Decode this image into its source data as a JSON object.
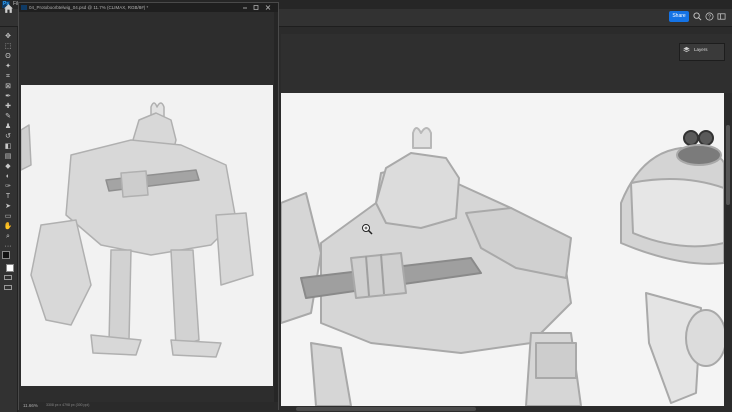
{
  "app": {
    "logo_text": "Ps",
    "menu_first": "File",
    "share_label": "Share"
  },
  "document": {
    "title": "04_Protoboorbtelwig_04.psd @ 11.7% (CLIMAX, RGB/8#) *",
    "zoom": "11.66%",
    "size_info": "3308 px x 4798 px (300 ppi)"
  },
  "panels": {
    "layers_label": "Layers"
  },
  "tools": [
    {
      "name": "move-tool",
      "glyph": "✥"
    },
    {
      "name": "marquee-tool",
      "glyph": "⬚"
    },
    {
      "name": "lasso-tool",
      "glyph": "ʘ"
    },
    {
      "name": "magic-wand-tool",
      "glyph": "✦"
    },
    {
      "name": "crop-tool",
      "glyph": "⌗"
    },
    {
      "name": "frame-tool",
      "glyph": "⊠"
    },
    {
      "name": "eyedropper-tool",
      "glyph": "✒"
    },
    {
      "name": "healing-tool",
      "glyph": "✚"
    },
    {
      "name": "brush-tool",
      "glyph": "✎"
    },
    {
      "name": "stamp-tool",
      "glyph": "♟"
    },
    {
      "name": "history-brush-tool",
      "glyph": "↺"
    },
    {
      "name": "eraser-tool",
      "glyph": "◧"
    },
    {
      "name": "gradient-tool",
      "glyph": "▤"
    },
    {
      "name": "blur-tool",
      "glyph": "◆"
    },
    {
      "name": "dodge-tool",
      "glyph": "◐"
    },
    {
      "name": "pen-tool",
      "glyph": "✑"
    },
    {
      "name": "type-tool",
      "glyph": "T"
    },
    {
      "name": "path-select-tool",
      "glyph": "➤"
    },
    {
      "name": "shape-tool",
      "glyph": "▭"
    },
    {
      "name": "hand-tool",
      "glyph": "✋"
    },
    {
      "name": "zoom-tool",
      "glyph": "⌕"
    },
    {
      "name": "more-tools",
      "glyph": "···"
    }
  ],
  "colors": {
    "accent": "#1473e6",
    "canvas": "#f4f4f4",
    "ui_dark": "#2b2b2b"
  }
}
